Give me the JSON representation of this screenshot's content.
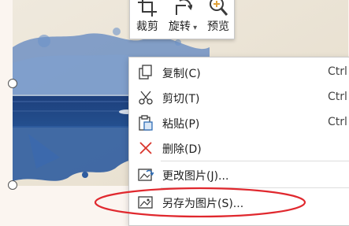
{
  "mini_toolbar": {
    "crop_label": "裁剪",
    "rotate_label": "旋转",
    "preview_label": "预览"
  },
  "context_menu": {
    "items": [
      {
        "label": "复制(C)",
        "shortcut": "Ctrl",
        "icon": "copy-icon"
      },
      {
        "label": "剪切(T)",
        "shortcut": "Ctrl",
        "icon": "scissors-icon"
      },
      {
        "label": "粘贴(P)",
        "shortcut": "Ctrl",
        "icon": "clipboard-icon"
      },
      {
        "label": "删除(D)",
        "shortcut": "",
        "icon": "delete-x-icon"
      },
      {
        "label": "更改图片(J)...",
        "shortcut": "",
        "icon": "change-picture-icon"
      },
      {
        "label": "另存为图片(S)...",
        "shortcut": "",
        "icon": "save-picture-icon"
      }
    ]
  },
  "colors": {
    "delete_icon": "#d9342b",
    "annotation": "#e0282e",
    "toolbar_icon": "#3a3a3a"
  }
}
